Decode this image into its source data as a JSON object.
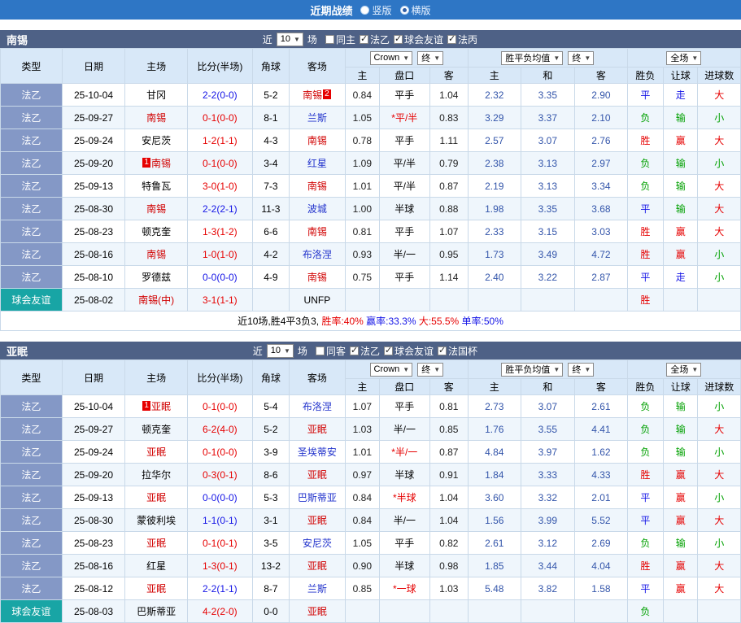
{
  "colors": {
    "topbar_bg": "#2E76C5",
    "teambar_bg": "#4E6186",
    "league_type_bg": "#8498C6",
    "friendly_type_bg": "#18A5A5",
    "win_red": "#E60000",
    "loss_green": "#00A000",
    "draw_blue": "#1414E6",
    "focal_team_red": "#D10000",
    "away_team_blue": "#2233CC",
    "avg_odds_blue": "#3355AA"
  },
  "topbar": {
    "title": "近期战绩",
    "radios": [
      {
        "label": "竖版",
        "selected": false
      },
      {
        "label": "横版",
        "selected": true
      }
    ]
  },
  "table_header": {
    "static_cols": [
      "类型",
      "日期",
      "主场",
      "比分(半场)",
      "角球",
      "客场"
    ],
    "bookmaker_select": "Crown",
    "final_select": "终",
    "avg_select": "胜平负均值",
    "final_select2": "终",
    "full_select": "全场",
    "odds_sub": [
      "主",
      "盘口",
      "客"
    ],
    "avg_sub": [
      "主",
      "和",
      "客"
    ],
    "result_sub": [
      "胜负",
      "让球",
      "进球数"
    ]
  },
  "sections": [
    {
      "team": "南锡",
      "filter": {
        "near": "近",
        "count": "10",
        "games": "场",
        "checks": [
          {
            "label": "同主",
            "checked": false
          },
          {
            "label": "法乙",
            "checked": true
          },
          {
            "label": "球会友谊",
            "checked": true
          },
          {
            "label": "法丙",
            "checked": true
          }
        ]
      },
      "rows": [
        {
          "type": "法乙",
          "tcls": "league",
          "date": "25-10-04",
          "home": {
            "name": "甘冈",
            "cls": "t-home"
          },
          "score": {
            "t": "2-2(0-0)",
            "c": "c-blue"
          },
          "corner": "5-2",
          "away": {
            "name": "南锡",
            "cls": "t-focal",
            "badge": "2",
            "bpos": "after"
          },
          "oh": "0.84",
          "line": {
            "t": "平手",
            "c": ""
          },
          "oa": "1.04",
          "ah": "2.32",
          "ad": "3.35",
          "aa": "2.90",
          "res": [
            {
              "t": "平",
              "c": "c-blue"
            },
            {
              "t": "走",
              "c": "c-blue"
            },
            {
              "t": "大",
              "c": "c-red"
            }
          ]
        },
        {
          "type": "法乙",
          "tcls": "league",
          "date": "25-09-27",
          "home": {
            "name": "南锡",
            "cls": "t-focal"
          },
          "score": {
            "t": "0-1(0-0)",
            "c": "c-red"
          },
          "corner": "8-1",
          "away": {
            "name": "兰斯",
            "cls": "t-away"
          },
          "oh": "1.05",
          "line": {
            "t": "*平/半",
            "c": "c-red"
          },
          "oa": "0.83",
          "ah": "3.29",
          "ad": "3.37",
          "aa": "2.10",
          "res": [
            {
              "t": "负",
              "c": "c-green"
            },
            {
              "t": "输",
              "c": "c-green"
            },
            {
              "t": "小",
              "c": "c-green"
            }
          ]
        },
        {
          "type": "法乙",
          "tcls": "league",
          "date": "25-09-24",
          "home": {
            "name": "安尼茨",
            "cls": "t-home"
          },
          "score": {
            "t": "1-2(1-1)",
            "c": "c-red"
          },
          "corner": "4-3",
          "away": {
            "name": "南锡",
            "cls": "t-focal"
          },
          "oh": "0.78",
          "line": {
            "t": "平手",
            "c": ""
          },
          "oa": "1.11",
          "ah": "2.57",
          "ad": "3.07",
          "aa": "2.76",
          "res": [
            {
              "t": "胜",
              "c": "c-red"
            },
            {
              "t": "赢",
              "c": "c-red"
            },
            {
              "t": "大",
              "c": "c-red"
            }
          ]
        },
        {
          "type": "法乙",
          "tcls": "league",
          "date": "25-09-20",
          "home": {
            "name": "南锡",
            "cls": "t-focal",
            "badge": "1",
            "bpos": "before"
          },
          "score": {
            "t": "0-1(0-0)",
            "c": "c-red"
          },
          "corner": "3-4",
          "away": {
            "name": "红星",
            "cls": "t-away"
          },
          "oh": "1.09",
          "line": {
            "t": "平/半",
            "c": ""
          },
          "oa": "0.79",
          "ah": "2.38",
          "ad": "3.13",
          "aa": "2.97",
          "res": [
            {
              "t": "负",
              "c": "c-green"
            },
            {
              "t": "输",
              "c": "c-green"
            },
            {
              "t": "小",
              "c": "c-green"
            }
          ]
        },
        {
          "type": "法乙",
          "tcls": "league",
          "date": "25-09-13",
          "home": {
            "name": "特鲁瓦",
            "cls": "t-home"
          },
          "score": {
            "t": "3-0(1-0)",
            "c": "c-red"
          },
          "corner": "7-3",
          "away": {
            "name": "南锡",
            "cls": "t-focal"
          },
          "oh": "1.01",
          "line": {
            "t": "平/半",
            "c": ""
          },
          "oa": "0.87",
          "ah": "2.19",
          "ad": "3.13",
          "aa": "3.34",
          "res": [
            {
              "t": "负",
              "c": "c-green"
            },
            {
              "t": "输",
              "c": "c-green"
            },
            {
              "t": "大",
              "c": "c-red"
            }
          ]
        },
        {
          "type": "法乙",
          "tcls": "league",
          "date": "25-08-30",
          "home": {
            "name": "南锡",
            "cls": "t-focal"
          },
          "score": {
            "t": "2-2(2-1)",
            "c": "c-blue"
          },
          "corner": "11-3",
          "away": {
            "name": "波城",
            "cls": "t-away"
          },
          "oh": "1.00",
          "line": {
            "t": "半球",
            "c": ""
          },
          "oa": "0.88",
          "ah": "1.98",
          "ad": "3.35",
          "aa": "3.68",
          "res": [
            {
              "t": "平",
              "c": "c-blue"
            },
            {
              "t": "输",
              "c": "c-green"
            },
            {
              "t": "大",
              "c": "c-red"
            }
          ]
        },
        {
          "type": "法乙",
          "tcls": "league",
          "date": "25-08-23",
          "home": {
            "name": "顿克奎",
            "cls": "t-home"
          },
          "score": {
            "t": "1-3(1-2)",
            "c": "c-red"
          },
          "corner": "6-6",
          "away": {
            "name": "南锡",
            "cls": "t-focal"
          },
          "oh": "0.81",
          "line": {
            "t": "平手",
            "c": ""
          },
          "oa": "1.07",
          "ah": "2.33",
          "ad": "3.15",
          "aa": "3.03",
          "res": [
            {
              "t": "胜",
              "c": "c-red"
            },
            {
              "t": "赢",
              "c": "c-red"
            },
            {
              "t": "大",
              "c": "c-red"
            }
          ]
        },
        {
          "type": "法乙",
          "tcls": "league",
          "date": "25-08-16",
          "home": {
            "name": "南锡",
            "cls": "t-focal"
          },
          "score": {
            "t": "1-0(1-0)",
            "c": "c-red"
          },
          "corner": "4-2",
          "away": {
            "name": "布洛涅",
            "cls": "t-away"
          },
          "oh": "0.93",
          "line": {
            "t": "半/一",
            "c": ""
          },
          "oa": "0.95",
          "ah": "1.73",
          "ad": "3.49",
          "aa": "4.72",
          "res": [
            {
              "t": "胜",
              "c": "c-red"
            },
            {
              "t": "赢",
              "c": "c-red"
            },
            {
              "t": "小",
              "c": "c-green"
            }
          ]
        },
        {
          "type": "法乙",
          "tcls": "league",
          "date": "25-08-10",
          "home": {
            "name": "罗德兹",
            "cls": "t-home"
          },
          "score": {
            "t": "0-0(0-0)",
            "c": "c-blue"
          },
          "corner": "4-9",
          "away": {
            "name": "南锡",
            "cls": "t-focal"
          },
          "oh": "0.75",
          "line": {
            "t": "平手",
            "c": ""
          },
          "oa": "1.14",
          "ah": "2.40",
          "ad": "3.22",
          "aa": "2.87",
          "res": [
            {
              "t": "平",
              "c": "c-blue"
            },
            {
              "t": "走",
              "c": "c-blue"
            },
            {
              "t": "小",
              "c": "c-green"
            }
          ]
        },
        {
          "type": "球会友谊",
          "tcls": "friendly",
          "date": "25-08-02",
          "home": {
            "name": "南锡(中)",
            "cls": "t-focal"
          },
          "score": {
            "t": "3-1(1-1)",
            "c": "c-red"
          },
          "corner": "",
          "away": {
            "name": "UNFP",
            "cls": "t-home"
          },
          "oh": "",
          "line": null,
          "oa": "",
          "ah": "",
          "ad": "",
          "aa": "",
          "res": [
            {
              "t": "胜",
              "c": "c-red"
            },
            null,
            null
          ]
        }
      ],
      "summary": [
        {
          "text": "近10场,胜4平3负3, ",
          "cls": "c-black"
        },
        {
          "text": "胜率:40% ",
          "cls": "c-red"
        },
        {
          "text": "赢率:33.3% ",
          "cls": "c-blue"
        },
        {
          "text": "大:55.5% ",
          "cls": "c-red"
        },
        {
          "text": "单率:50%",
          "cls": "c-blue"
        }
      ]
    },
    {
      "team": "亚眠",
      "filter": {
        "near": "近",
        "count": "10",
        "games": "场",
        "checks": [
          {
            "label": "同客",
            "checked": false
          },
          {
            "label": "法乙",
            "checked": true
          },
          {
            "label": "球会友谊",
            "checked": true
          },
          {
            "label": "法国杯",
            "checked": true
          }
        ]
      },
      "rows": [
        {
          "type": "法乙",
          "tcls": "league",
          "date": "25-10-04",
          "home": {
            "name": "亚眠",
            "cls": "t-focal",
            "badge": "1",
            "bpos": "before"
          },
          "score": {
            "t": "0-1(0-0)",
            "c": "c-red"
          },
          "corner": "5-4",
          "away": {
            "name": "布洛涅",
            "cls": "t-away"
          },
          "oh": "1.07",
          "line": {
            "t": "平手",
            "c": ""
          },
          "oa": "0.81",
          "ah": "2.73",
          "ad": "3.07",
          "aa": "2.61",
          "res": [
            {
              "t": "负",
              "c": "c-green"
            },
            {
              "t": "输",
              "c": "c-green"
            },
            {
              "t": "小",
              "c": "c-green"
            }
          ]
        },
        {
          "type": "法乙",
          "tcls": "league",
          "date": "25-09-27",
          "home": {
            "name": "顿克奎",
            "cls": "t-home"
          },
          "score": {
            "t": "6-2(4-0)",
            "c": "c-red"
          },
          "corner": "5-2",
          "away": {
            "name": "亚眠",
            "cls": "t-focal"
          },
          "oh": "1.03",
          "line": {
            "t": "半/一",
            "c": ""
          },
          "oa": "0.85",
          "ah": "1.76",
          "ad": "3.55",
          "aa": "4.41",
          "res": [
            {
              "t": "负",
              "c": "c-green"
            },
            {
              "t": "输",
              "c": "c-green"
            },
            {
              "t": "大",
              "c": "c-red"
            }
          ]
        },
        {
          "type": "法乙",
          "tcls": "league",
          "date": "25-09-24",
          "home": {
            "name": "亚眠",
            "cls": "t-focal"
          },
          "score": {
            "t": "0-1(0-0)",
            "c": "c-red"
          },
          "corner": "3-9",
          "away": {
            "name": "圣埃蒂安",
            "cls": "t-away"
          },
          "oh": "1.01",
          "line": {
            "t": "*半/一",
            "c": "c-red"
          },
          "oa": "0.87",
          "ah": "4.84",
          "ad": "3.97",
          "aa": "1.62",
          "res": [
            {
              "t": "负",
              "c": "c-green"
            },
            {
              "t": "输",
              "c": "c-green"
            },
            {
              "t": "小",
              "c": "c-green"
            }
          ]
        },
        {
          "type": "法乙",
          "tcls": "league",
          "date": "25-09-20",
          "home": {
            "name": "拉华尔",
            "cls": "t-home"
          },
          "score": {
            "t": "0-3(0-1)",
            "c": "c-red"
          },
          "corner": "8-6",
          "away": {
            "name": "亚眠",
            "cls": "t-focal"
          },
          "oh": "0.97",
          "line": {
            "t": "半球",
            "c": ""
          },
          "oa": "0.91",
          "ah": "1.84",
          "ad": "3.33",
          "aa": "4.33",
          "res": [
            {
              "t": "胜",
              "c": "c-red"
            },
            {
              "t": "赢",
              "c": "c-red"
            },
            {
              "t": "大",
              "c": "c-red"
            }
          ]
        },
        {
          "type": "法乙",
          "tcls": "league",
          "date": "25-09-13",
          "home": {
            "name": "亚眠",
            "cls": "t-focal"
          },
          "score": {
            "t": "0-0(0-0)",
            "c": "c-blue"
          },
          "corner": "5-3",
          "away": {
            "name": "巴斯蒂亚",
            "cls": "t-away"
          },
          "oh": "0.84",
          "line": {
            "t": "*半球",
            "c": "c-red"
          },
          "oa": "1.04",
          "ah": "3.60",
          "ad": "3.32",
          "aa": "2.01",
          "res": [
            {
              "t": "平",
              "c": "c-blue"
            },
            {
              "t": "赢",
              "c": "c-red"
            },
            {
              "t": "小",
              "c": "c-green"
            }
          ]
        },
        {
          "type": "法乙",
          "tcls": "league",
          "date": "25-08-30",
          "home": {
            "name": "蒙彼利埃",
            "cls": "t-home"
          },
          "score": {
            "t": "1-1(0-1)",
            "c": "c-blue"
          },
          "corner": "3-1",
          "away": {
            "name": "亚眠",
            "cls": "t-focal"
          },
          "oh": "0.84",
          "line": {
            "t": "半/一",
            "c": ""
          },
          "oa": "1.04",
          "ah": "1.56",
          "ad": "3.99",
          "aa": "5.52",
          "res": [
            {
              "t": "平",
              "c": "c-blue"
            },
            {
              "t": "赢",
              "c": "c-red"
            },
            {
              "t": "大",
              "c": "c-red"
            }
          ]
        },
        {
          "type": "法乙",
          "tcls": "league",
          "date": "25-08-23",
          "home": {
            "name": "亚眠",
            "cls": "t-focal"
          },
          "score": {
            "t": "0-1(0-1)",
            "c": "c-red"
          },
          "corner": "3-5",
          "away": {
            "name": "安尼茨",
            "cls": "t-away"
          },
          "oh": "1.05",
          "line": {
            "t": "平手",
            "c": ""
          },
          "oa": "0.82",
          "ah": "2.61",
          "ad": "3.12",
          "aa": "2.69",
          "res": [
            {
              "t": "负",
              "c": "c-green"
            },
            {
              "t": "输",
              "c": "c-green"
            },
            {
              "t": "小",
              "c": "c-green"
            }
          ]
        },
        {
          "type": "法乙",
          "tcls": "league",
          "date": "25-08-16",
          "home": {
            "name": "红星",
            "cls": "t-home"
          },
          "score": {
            "t": "1-3(0-1)",
            "c": "c-red"
          },
          "corner": "13-2",
          "away": {
            "name": "亚眠",
            "cls": "t-focal"
          },
          "oh": "0.90",
          "line": {
            "t": "半球",
            "c": ""
          },
          "oa": "0.98",
          "ah": "1.85",
          "ad": "3.44",
          "aa": "4.04",
          "res": [
            {
              "t": "胜",
              "c": "c-red"
            },
            {
              "t": "赢",
              "c": "c-red"
            },
            {
              "t": "大",
              "c": "c-red"
            }
          ]
        },
        {
          "type": "法乙",
          "tcls": "league",
          "date": "25-08-12",
          "home": {
            "name": "亚眠",
            "cls": "t-focal"
          },
          "score": {
            "t": "2-2(1-1)",
            "c": "c-blue"
          },
          "corner": "8-7",
          "away": {
            "name": "兰斯",
            "cls": "t-away"
          },
          "oh": "0.85",
          "line": {
            "t": "*一球",
            "c": "c-red"
          },
          "oa": "1.03",
          "ah": "5.48",
          "ad": "3.82",
          "aa": "1.58",
          "res": [
            {
              "t": "平",
              "c": "c-blue"
            },
            {
              "t": "赢",
              "c": "c-red"
            },
            {
              "t": "大",
              "c": "c-red"
            }
          ]
        },
        {
          "type": "球会友谊",
          "tcls": "friendly",
          "date": "25-08-03",
          "home": {
            "name": "巴斯蒂亚",
            "cls": "t-home"
          },
          "score": {
            "t": "4-2(2-0)",
            "c": "c-red"
          },
          "corner": "0-0",
          "away": {
            "name": "亚眠",
            "cls": "t-focal"
          },
          "oh": "",
          "line": null,
          "oa": "",
          "ah": "",
          "ad": "",
          "aa": "",
          "res": [
            {
              "t": "负",
              "c": "c-green"
            },
            null,
            null
          ]
        }
      ],
      "summary": []
    }
  ]
}
